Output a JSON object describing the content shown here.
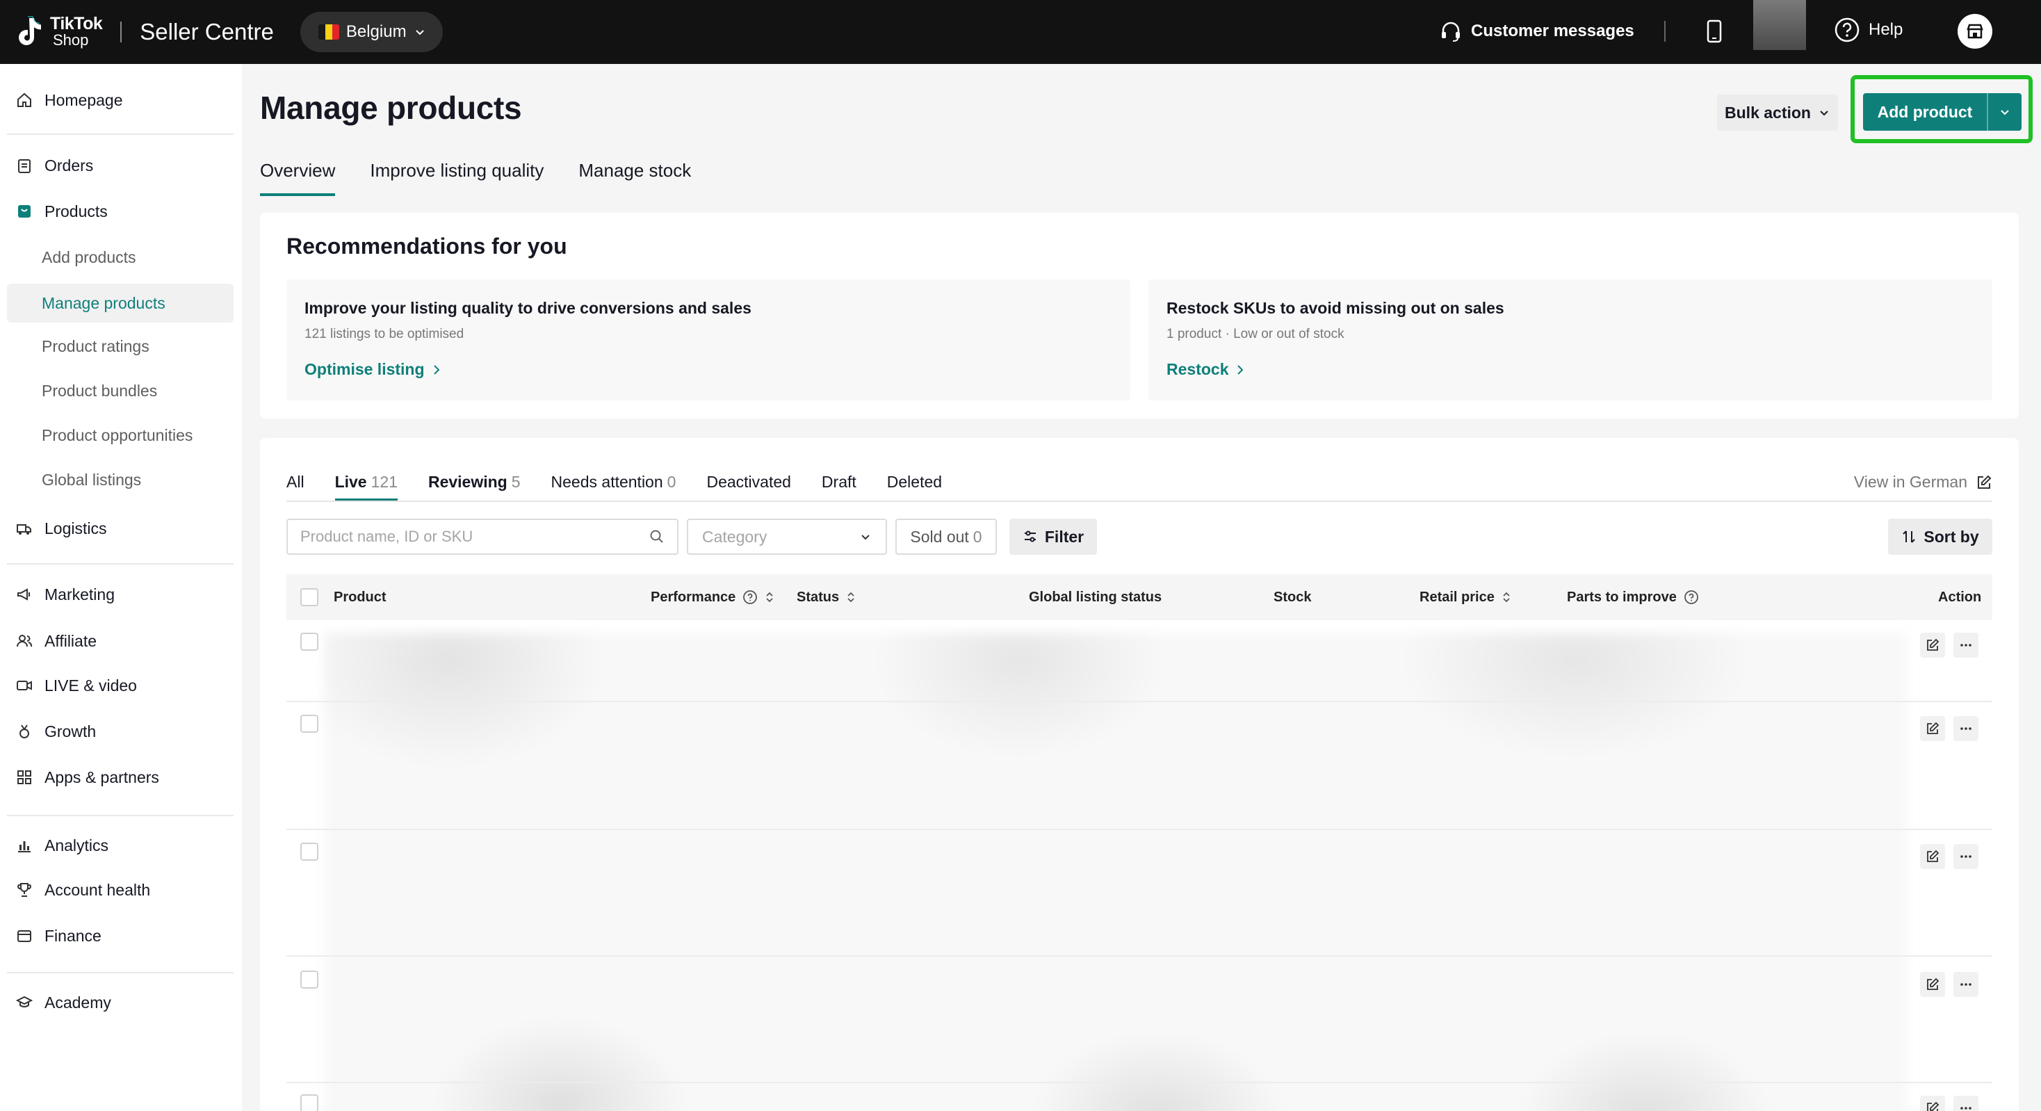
{
  "header": {
    "logo_line1": "TikTok",
    "logo_line2": "Shop",
    "title": "Seller Centre",
    "region": "Belgium",
    "customer_messages": "Customer messages",
    "help": "Help"
  },
  "sidebar": {
    "items": [
      {
        "label": "Homepage",
        "icon": "home-icon"
      },
      {
        "label": "Orders",
        "icon": "clipboard-icon"
      },
      {
        "label": "Products",
        "icon": "product-icon"
      },
      {
        "label": "Add products"
      },
      {
        "label": "Manage products"
      },
      {
        "label": "Product ratings"
      },
      {
        "label": "Product bundles"
      },
      {
        "label": "Product opportunities"
      },
      {
        "label": "Global listings"
      },
      {
        "label": "Logistics",
        "icon": "truck-icon"
      },
      {
        "label": "Marketing",
        "icon": "megaphone-icon"
      },
      {
        "label": "Affiliate",
        "icon": "users-icon"
      },
      {
        "label": "LIVE & video",
        "icon": "video-icon"
      },
      {
        "label": "Growth",
        "icon": "medal-icon"
      },
      {
        "label": "Apps & partners",
        "icon": "apps-icon"
      },
      {
        "label": "Analytics",
        "icon": "bar-chart-icon"
      },
      {
        "label": "Account health",
        "icon": "trophy-icon"
      },
      {
        "label": "Finance",
        "icon": "wallet-icon"
      },
      {
        "label": "Academy",
        "icon": "graduation-icon"
      }
    ]
  },
  "page": {
    "title": "Manage products",
    "bulk_action": "Bulk action",
    "add_product": "Add product",
    "tabs": [
      "Overview",
      "Improve listing quality",
      "Manage stock"
    ]
  },
  "recommendations": {
    "title": "Recommendations for you",
    "cards": [
      {
        "heading": "Improve your listing quality to drive conversions and sales",
        "sub": "121 listings to be optimised",
        "action": "Optimise listing"
      },
      {
        "heading": "Restock SKUs to avoid missing out on sales",
        "sub": "1 product · Low or out of stock",
        "action": "Restock"
      }
    ]
  },
  "list": {
    "status_tabs": [
      {
        "label": "All",
        "count": ""
      },
      {
        "label": "Live",
        "count": "121"
      },
      {
        "label": "Reviewing",
        "count": "5"
      },
      {
        "label": "Needs attention",
        "count": "0"
      },
      {
        "label": "Deactivated",
        "count": ""
      },
      {
        "label": "Draft",
        "count": ""
      },
      {
        "label": "Deleted",
        "count": ""
      }
    ],
    "view_in": "View in German",
    "search_placeholder": "Product name, ID or SKU",
    "category_placeholder": "Category",
    "sold_out_label": "Sold out",
    "sold_out_count": "0",
    "filter": "Filter",
    "sort_by": "Sort by",
    "columns": [
      "Product",
      "Performance",
      "Status",
      "Global listing status",
      "Stock",
      "Retail price",
      "Parts to improve",
      "Action"
    ]
  },
  "colors": {
    "accent": "#0f7f7a",
    "highlight": "#1fc023",
    "topbar": "#121212"
  }
}
